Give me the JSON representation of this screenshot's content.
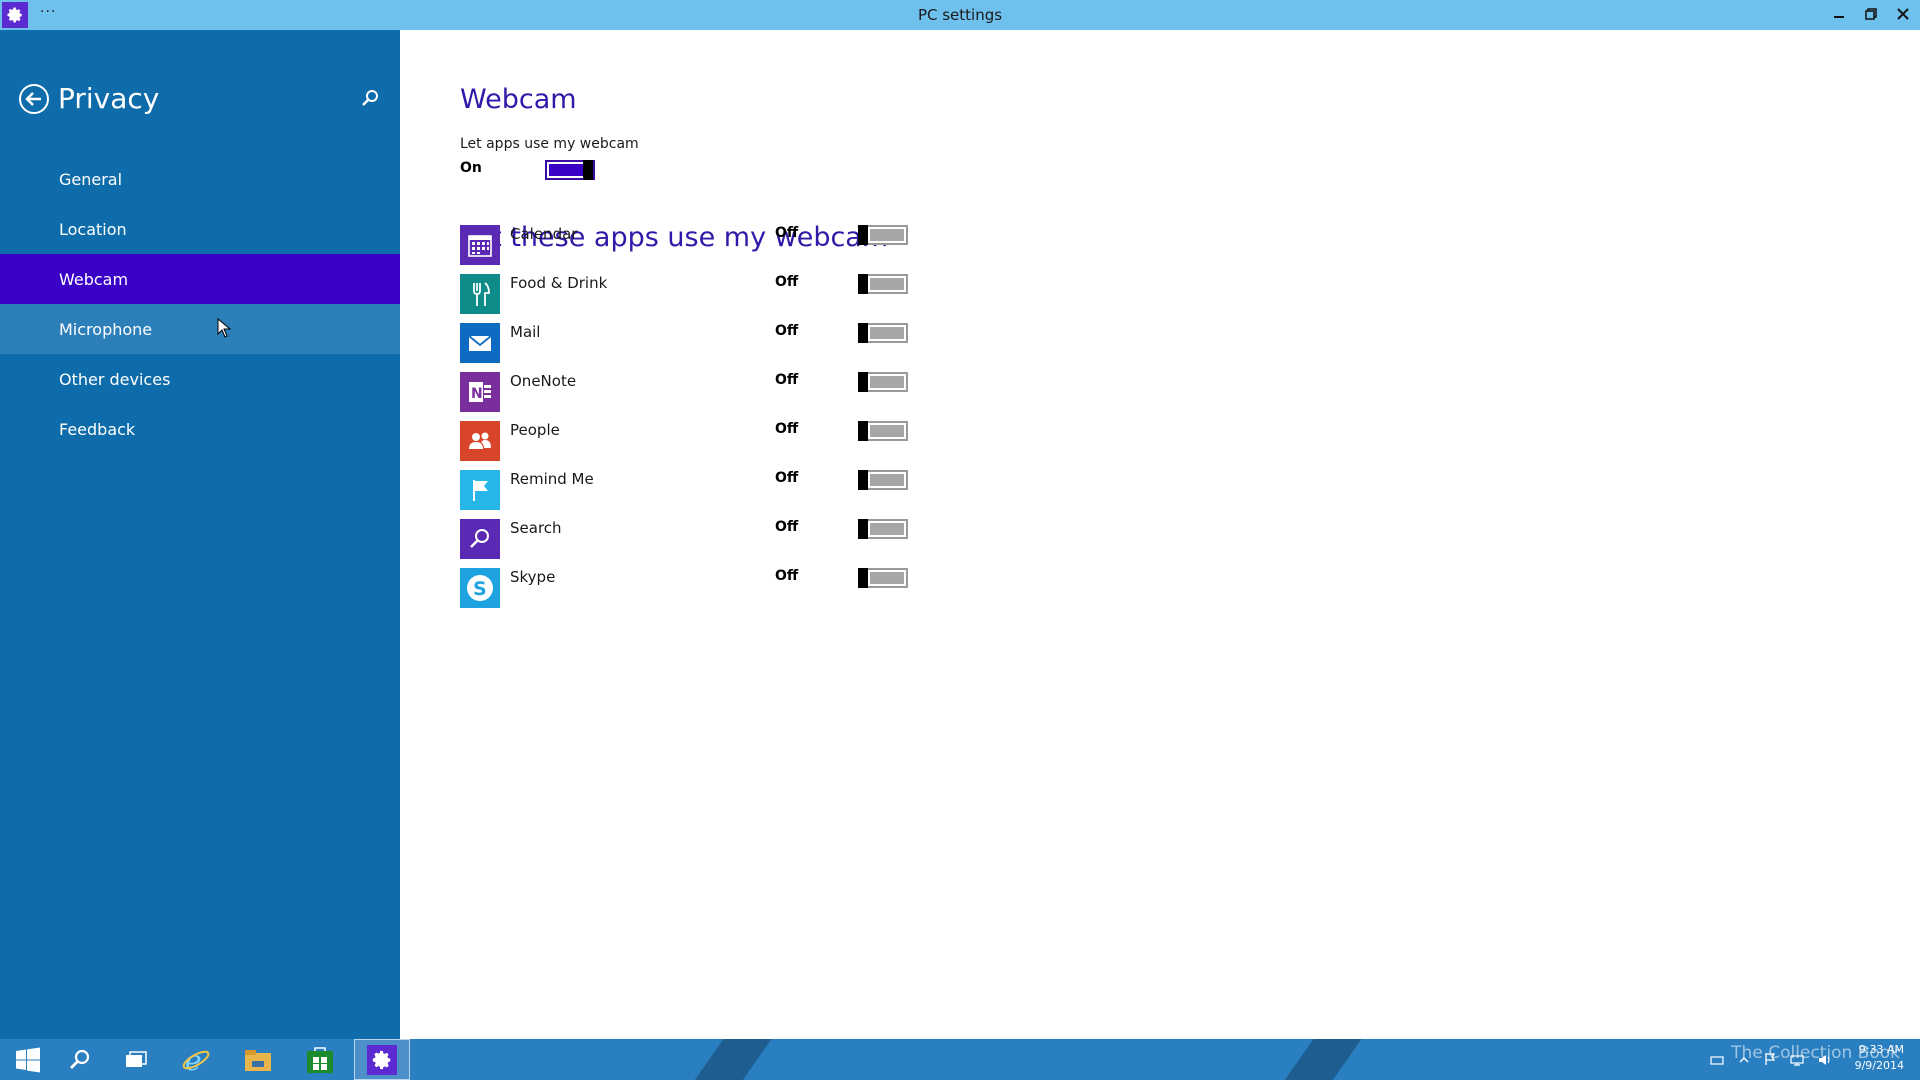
{
  "window": {
    "title": "PC settings",
    "menu_glyph": "···",
    "app_icon": "gear-icon"
  },
  "sidebar": {
    "title": "Privacy",
    "items": [
      {
        "label": "General"
      },
      {
        "label": "Location"
      },
      {
        "label": "Webcam",
        "selected": true
      },
      {
        "label": "Microphone",
        "hovered": true
      },
      {
        "label": "Other devices"
      },
      {
        "label": "Feedback"
      }
    ]
  },
  "main": {
    "heading": "Webcam",
    "master": {
      "label": "Let apps use my webcam",
      "state": "On",
      "on": true
    },
    "apps_heading": "Let these apps use my webcam",
    "apps": [
      {
        "name": "Calendar",
        "state": "Off",
        "color": "#5a2ab5",
        "icon": "calendar-icon"
      },
      {
        "name": "Food & Drink",
        "state": "Off",
        "color": "#0f8c8a",
        "icon": "fork-knife-icon"
      },
      {
        "name": "Mail",
        "state": "Off",
        "color": "#0d6bc2",
        "icon": "envelope-icon"
      },
      {
        "name": "OneNote",
        "state": "Off",
        "color": "#7a2e9e",
        "icon": "onenote-icon"
      },
      {
        "name": "People",
        "state": "Off",
        "color": "#d9452b",
        "icon": "people-icon"
      },
      {
        "name": "Remind Me",
        "state": "Off",
        "color": "#26b7e8",
        "icon": "flag-icon"
      },
      {
        "name": "Search",
        "state": "Off",
        "color": "#5a2ab5",
        "icon": "search-icon"
      },
      {
        "name": "Skype",
        "state": "Off",
        "color": "#1fa3e0",
        "icon": "skype-icon"
      }
    ]
  },
  "taskbar": {
    "time": "9:33 AM",
    "date": "9/9/2014",
    "watermark": "The Collection Book"
  },
  "colors": {
    "accent": "#3a00c8",
    "sidebar": "#0e6cab",
    "titlebar": "#6ec1ec",
    "taskbar": "#2a7fc0"
  }
}
